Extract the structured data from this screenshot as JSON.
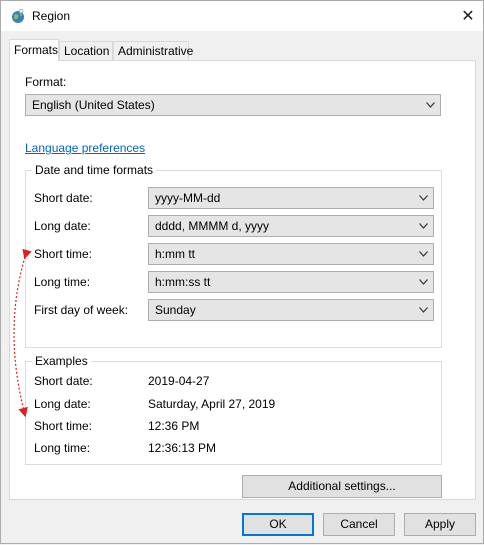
{
  "window": {
    "title": "Region",
    "close_glyph": "✕"
  },
  "tabs": [
    {
      "label": "Formats",
      "active": true
    },
    {
      "label": "Location",
      "active": false
    },
    {
      "label": "Administrative",
      "active": false
    }
  ],
  "format": {
    "label": "Format:",
    "value": "English (United States)"
  },
  "language_link": "Language preferences",
  "date_time": {
    "group_title": "Date and time formats",
    "rows": [
      {
        "label": "Short date:",
        "value": "yyyy-MM-dd"
      },
      {
        "label": "Long date:",
        "value": "dddd, MMMM d, yyyy"
      },
      {
        "label": "Short time:",
        "value": "h:mm tt"
      },
      {
        "label": "Long time:",
        "value": "h:mm:ss tt"
      },
      {
        "label": "First day of week:",
        "value": "Sunday"
      }
    ]
  },
  "examples": {
    "group_title": "Examples",
    "rows": [
      {
        "label": "Short date:",
        "value": "2019-04-27"
      },
      {
        "label": "Long date:",
        "value": "Saturday, April 27, 2019"
      },
      {
        "label": "Short time:",
        "value": "12:36 PM"
      },
      {
        "label": "Long time:",
        "value": "12:36:13 PM"
      }
    ]
  },
  "additional_settings": "Additional settings...",
  "buttons": {
    "ok": "OK",
    "cancel": "Cancel",
    "apply": "Apply"
  },
  "colors": {
    "link": "#0066cc",
    "annotation_arrow": "#e02020",
    "default_button_border": "#0078d7"
  }
}
